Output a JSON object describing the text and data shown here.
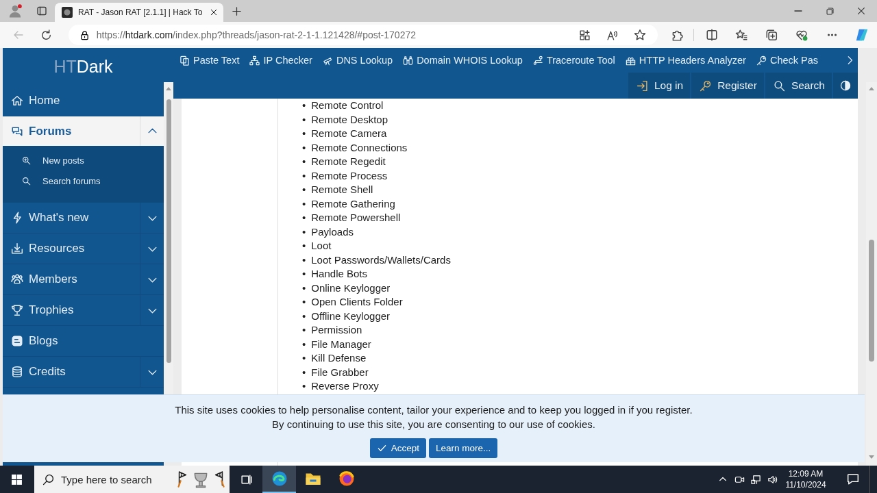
{
  "browser": {
    "tab": {
      "title": "RAT - Jason RAT [2.1.1] | Hack To"
    },
    "url": "https://**htdark.com**/index.php?threads/jason-rat-2-1-1.121428/#post-170272"
  },
  "site": {
    "logo": {
      "light": "HT",
      "bold": "Dark"
    },
    "tools": [
      "Paste Text",
      "IP Checker",
      "DNS Lookup",
      "Domain WHOIS Lookup",
      "Traceroute Tool",
      "HTTP Headers Analyzer",
      "Check Pas"
    ],
    "user_nav": [
      "Log in",
      "Register",
      "Search"
    ]
  },
  "sidebar": {
    "items": [
      {
        "label": "Home",
        "kind": "link",
        "selected": false
      },
      {
        "label": "Forums",
        "kind": "menu",
        "selected": true,
        "expanded": true,
        "children": [
          {
            "label": "New posts"
          },
          {
            "label": "Search forums"
          }
        ]
      },
      {
        "label": "What's new",
        "kind": "menu",
        "selected": false,
        "expanded": false
      },
      {
        "label": "Resources",
        "kind": "menu",
        "selected": false,
        "expanded": false
      },
      {
        "label": "Members",
        "kind": "menu",
        "selected": false,
        "expanded": false
      },
      {
        "label": "Trophies",
        "kind": "menu",
        "selected": false,
        "expanded": false
      },
      {
        "label": "Blogs",
        "kind": "link",
        "selected": false
      },
      {
        "label": "Credits",
        "kind": "menu",
        "selected": false,
        "expanded": false
      }
    ]
  },
  "post": {
    "marker": "•",
    "items": [
      "Remote Control",
      "Remote Desktop",
      "Remote Camera",
      "Remote Connections",
      "Remote Regedit",
      "Remote Process",
      "Remote Shell",
      "Remote Gathering",
      "Remote Powershell",
      "Payloads",
      "Loot",
      "Loot Passwords/Wallets/Cards",
      "Handle Bots",
      "Online Keylogger",
      "Open Clients Folder",
      "Offline Keylogger",
      "Permission",
      "File Manager",
      "Kill Defense",
      "File Grabber",
      "Reverse Proxy"
    ]
  },
  "cookie_notice": {
    "lines": [
      "This site uses cookies to help personalise content, tailor your experience and to keep you logged in if you register.",
      "By continuing to use this site, you are consenting to our use of cookies."
    ],
    "buttons": [
      "Accept",
      "Learn more..."
    ]
  },
  "taskbar": {
    "search": {
      "placeholder": "Type here to search"
    },
    "apps": [
      {
        "selected": true
      },
      {
        "selected": false
      },
      {
        "selected": false
      }
    ],
    "time": "12:09 AM",
    "date": "11/10/2024"
  }
}
